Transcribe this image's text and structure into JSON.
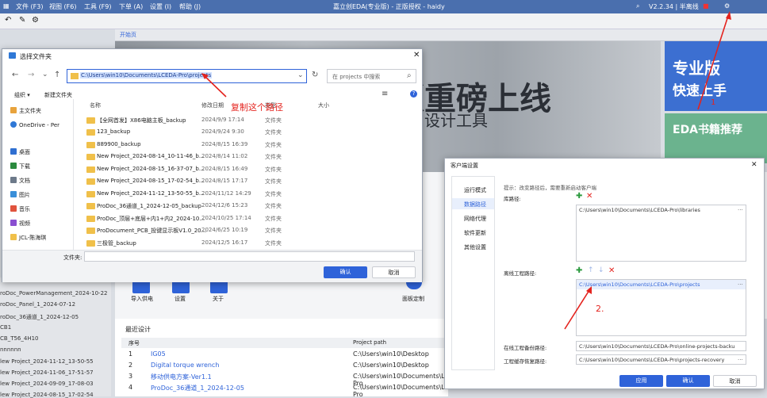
{
  "app": {
    "menus": [
      "文件 (F3)",
      "视图 (F6)",
      "工具 (F9)",
      "下单 (A)",
      "设置 (I)",
      "帮助 (J)"
    ],
    "title": "嘉立创EDA(专业版) - 正版授权 - haidy",
    "version": "V2.2.34 | 半离线",
    "home_tab": "开始页"
  },
  "banner": {
    "headline": "版重磅上线",
    "sub": "设计工具"
  },
  "promo": {
    "pro_line1": "专业版",
    "pro_line2": "快速上手",
    "books": "EDA书籍推荐",
    "num1": "1"
  },
  "actions": [
    "导入供电",
    "设置",
    "关于",
    "面板定制"
  ],
  "left_list": [
    "roDoc_PowerManagement_2024-10-22",
    "roDoc_Panel_1_2024-07-12",
    "roDoc_36通道_1_2024-12-05",
    "CB1",
    "CB_T56_4H10",
    "nnnnnn",
    "lew Project_2024-11-12_13-50-55",
    "lew Project_2024-11-06_17-51-57",
    "lew Project_2024-09-09_17-08-03",
    "lew Project_2024-08-15_17-02-54"
  ],
  "recent": {
    "title": "最近设计",
    "col_no": "序号",
    "col_path": "Project path",
    "rows": [
      {
        "no": "1",
        "name": "IG05",
        "path": "C:\\Users\\win10\\Desktop"
      },
      {
        "no": "2",
        "name": "Digital torque wrench",
        "path": "C:\\Users\\win10\\Desktop"
      },
      {
        "no": "3",
        "name": "移动供电方案-Ver1.1",
        "path": "C:\\Users\\win10\\Documents\\LCEDA-Pro"
      },
      {
        "no": "4",
        "name": "ProDoc_36通道_1_2024-12-05",
        "path": "C:\\Users\\win10\\Documents\\LCEDA-Pro"
      }
    ]
  },
  "file_dialog": {
    "title": "选择文件夹",
    "address": "C:\\Users\\win10\\Documents\\LCEDA-Pro\\projects",
    "search_placeholder": "在 projects 中搜索",
    "organize": "组织 ▾",
    "new_folder": "新建文件夹",
    "annotation": "复制这个路径",
    "headers": {
      "name": "名称",
      "date": "修改日期",
      "type": "类型",
      "size": "大小"
    },
    "nav": [
      {
        "label": "主文件夹",
        "color": "#e8a33c"
      },
      {
        "label": "OneDrive - Per",
        "color": "#2f78d6"
      },
      {
        "label": "桌面",
        "color": "#2f6fd1"
      },
      {
        "label": "下载",
        "color": "#2b8a3e"
      },
      {
        "label": "文档",
        "color": "#6d7a8a"
      },
      {
        "label": "图片",
        "color": "#3a8fd9"
      },
      {
        "label": "音乐",
        "color": "#e0533d"
      },
      {
        "label": "视频",
        "color": "#8a4fd1"
      },
      {
        "label": "JCL-陈海琪",
        "color": "#f0c04a"
      }
    ],
    "files": [
      {
        "name": "【全网首发】X86电脑主板_backup",
        "date": "2024/9/9 17:14",
        "type": "文件夹"
      },
      {
        "name": "123_backup",
        "date": "2024/9/24 9:30",
        "type": "文件夹"
      },
      {
        "name": "889900_backup",
        "date": "2024/8/15 16:39",
        "type": "文件夹"
      },
      {
        "name": "New Project_2024-08-14_10-11-46_b...",
        "date": "2024/8/14 11:02",
        "type": "文件夹"
      },
      {
        "name": "New Project_2024-08-15_16-37-07_b...",
        "date": "2024/8/15 16:49",
        "type": "文件夹"
      },
      {
        "name": "New Project_2024-08-15_17-02-54_b...",
        "date": "2024/8/15 17:17",
        "type": "文件夹"
      },
      {
        "name": "New Project_2024-11-12_13-50-55_b...",
        "date": "2024/11/12 14:29",
        "type": "文件夹"
      },
      {
        "name": "ProDoc_36通道_1_2024-12-05_backup",
        "date": "2024/12/6 15:23",
        "type": "文件夹"
      },
      {
        "name": "ProDoc_顶层+底层+内1+内2_2024-10...",
        "date": "2024/10/25 17:14",
        "type": "文件夹"
      },
      {
        "name": "ProDocument_PCB_投键显示板V1.0_20...",
        "date": "2024/6/25 10:19",
        "type": "文件夹"
      },
      {
        "name": "三极管_backup",
        "date": "2024/12/5 16:17",
        "type": "文件夹"
      }
    ],
    "folder_label": "文件夹:",
    "ok": "确认",
    "cancel": "取消"
  },
  "settings_dialog": {
    "title": "客户端设置",
    "nav": [
      "运行模式",
      "数据路径",
      "网络代理",
      "软件更新",
      "其他设置"
    ],
    "hint": "提示：改变路径后，需要重新启动客户端",
    "lib_label": "库路径:",
    "lib_path": "C:\\Users\\win10\\Documents\\LCEDA-Pro\\libraries",
    "offline_label": "离线工程路径:",
    "offline_path": "C:\\Users\\win10\\Documents\\LCEDA-Pro\\projects",
    "online_backup_label": "在线工程备份路径:",
    "online_backup_path": "C:\\Users\\win10\\Documents\\LCEDA-Pro\\online-projects-backu",
    "recovery_label": "工程缓存恢复路径:",
    "recovery_path": "C:\\Users\\win10\\Documents\\LCEDA-Pro\\projects-recovery",
    "annotation": "2.",
    "apply": "应用",
    "ok": "确认",
    "cancel": "取消"
  }
}
